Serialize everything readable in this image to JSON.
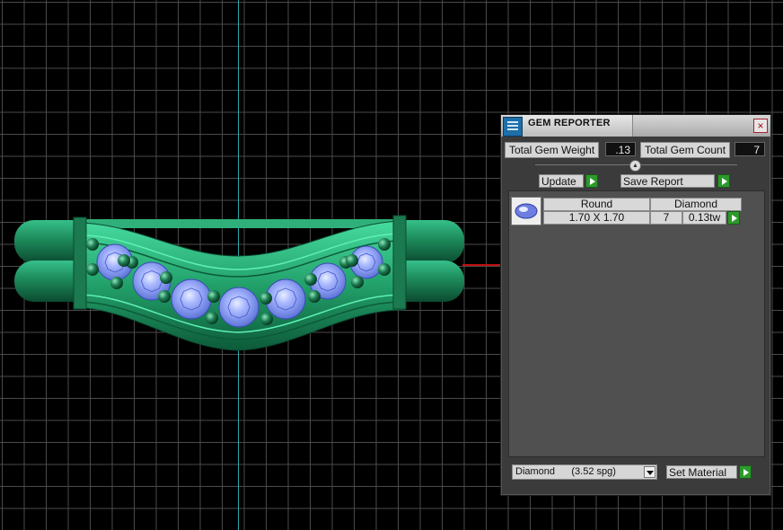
{
  "panel": {
    "title": "GEM REPORTER",
    "close_glyph": "×",
    "total_gem_weight_label": "Total Gem Weight",
    "total_gem_weight_value": ".13",
    "total_gem_count_label": "Total Gem Count",
    "total_gem_count_value": "7",
    "update_button": "Update",
    "save_report_button": "Save Report",
    "gem_list": [
      {
        "shape": "Round",
        "material": "Diamond",
        "size": "1.70 X 1.70",
        "count": "7",
        "weight": "0.13tw"
      }
    ],
    "material_select": {
      "selected": "Diamond      (3.52 spg)"
    },
    "set_material_button": "Set Material"
  },
  "colors": {
    "viewport_background": "#000000",
    "grid": "#4a4a4a",
    "vertical_axis": "#2aa8b0",
    "horizontal_axis": "#c01010",
    "ring_metal": "#1f8a5a",
    "gem_stone": "#8ea6ff",
    "panel_background": "#3b3b3b",
    "action_green": "#2b9a2b"
  },
  "icons": {
    "logo": "gem-reporter-logo-icon",
    "close": "close-icon",
    "collapse": "collapse-knob-icon",
    "action": "play-arrow-icon",
    "thumbnail": "round-gem-icon",
    "dropdown": "chevron-down-icon"
  }
}
